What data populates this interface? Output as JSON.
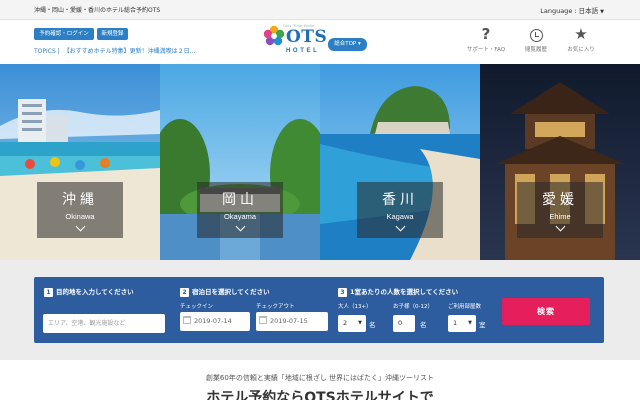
{
  "topstrip": {
    "tagline": "沖縄・岡山・愛媛・香川のホテル総合予約OTS",
    "language_label": "Language : 日本語"
  },
  "header": {
    "login_button": "予約確認・ログイン",
    "register_button": "新規登録",
    "topics_label": "TOPICS |",
    "topics_item": "【おすすめホテル特集】更新！沖縄満喫は２日…",
    "logo_tagline": "Only Time Smile",
    "logo_brand": "OTS",
    "logo_sub": "HOTEL",
    "top_button": "総合TOP",
    "nav": [
      {
        "label": "サポート・FAQ",
        "icon": "question-icon"
      },
      {
        "label": "閲覧履歴",
        "icon": "clock-icon"
      },
      {
        "label": "お気に入り",
        "icon": "star-icon"
      }
    ]
  },
  "regions": [
    {
      "jp": "沖縄",
      "en": "Okinawa"
    },
    {
      "jp": "岡山",
      "en": "Okayama"
    },
    {
      "jp": "香川",
      "en": "Kagawa"
    },
    {
      "jp": "愛媛",
      "en": "Ehime"
    }
  ],
  "search": {
    "step1_num": "1",
    "step1": "目的地を入力してください",
    "destination_placeholder": "エリア、空港、観光施設など",
    "step2_num": "2",
    "step2": "宿泊日を選択してください",
    "checkin_label": "チェックイン",
    "checkin_value": "2019-07-14",
    "checkout_label": "チェックアウト",
    "checkout_value": "2019-07-15",
    "step3_num": "3",
    "step3": "1室あたりの人数を選択してください",
    "adults_label": "大人（13+）",
    "adults_value": "2",
    "adults_unit": "名",
    "children_label": "お子様（0-12）",
    "children_value": "0",
    "children_unit": "名",
    "rooms_label": "ご利用部屋数",
    "rooms_value": "1",
    "rooms_unit": "室",
    "submit": "検索"
  },
  "bottom": {
    "tagline": "創業60年の信頼と実績「地域に根ざし 世界にはばたく」沖縄ツーリスト",
    "headline": "ホテル予約ならOTSホテルサイトで"
  },
  "colors": {
    "primary_blue": "#2c7fc4",
    "search_bg": "#2d5d9e",
    "search_button": "#e51f5c"
  }
}
